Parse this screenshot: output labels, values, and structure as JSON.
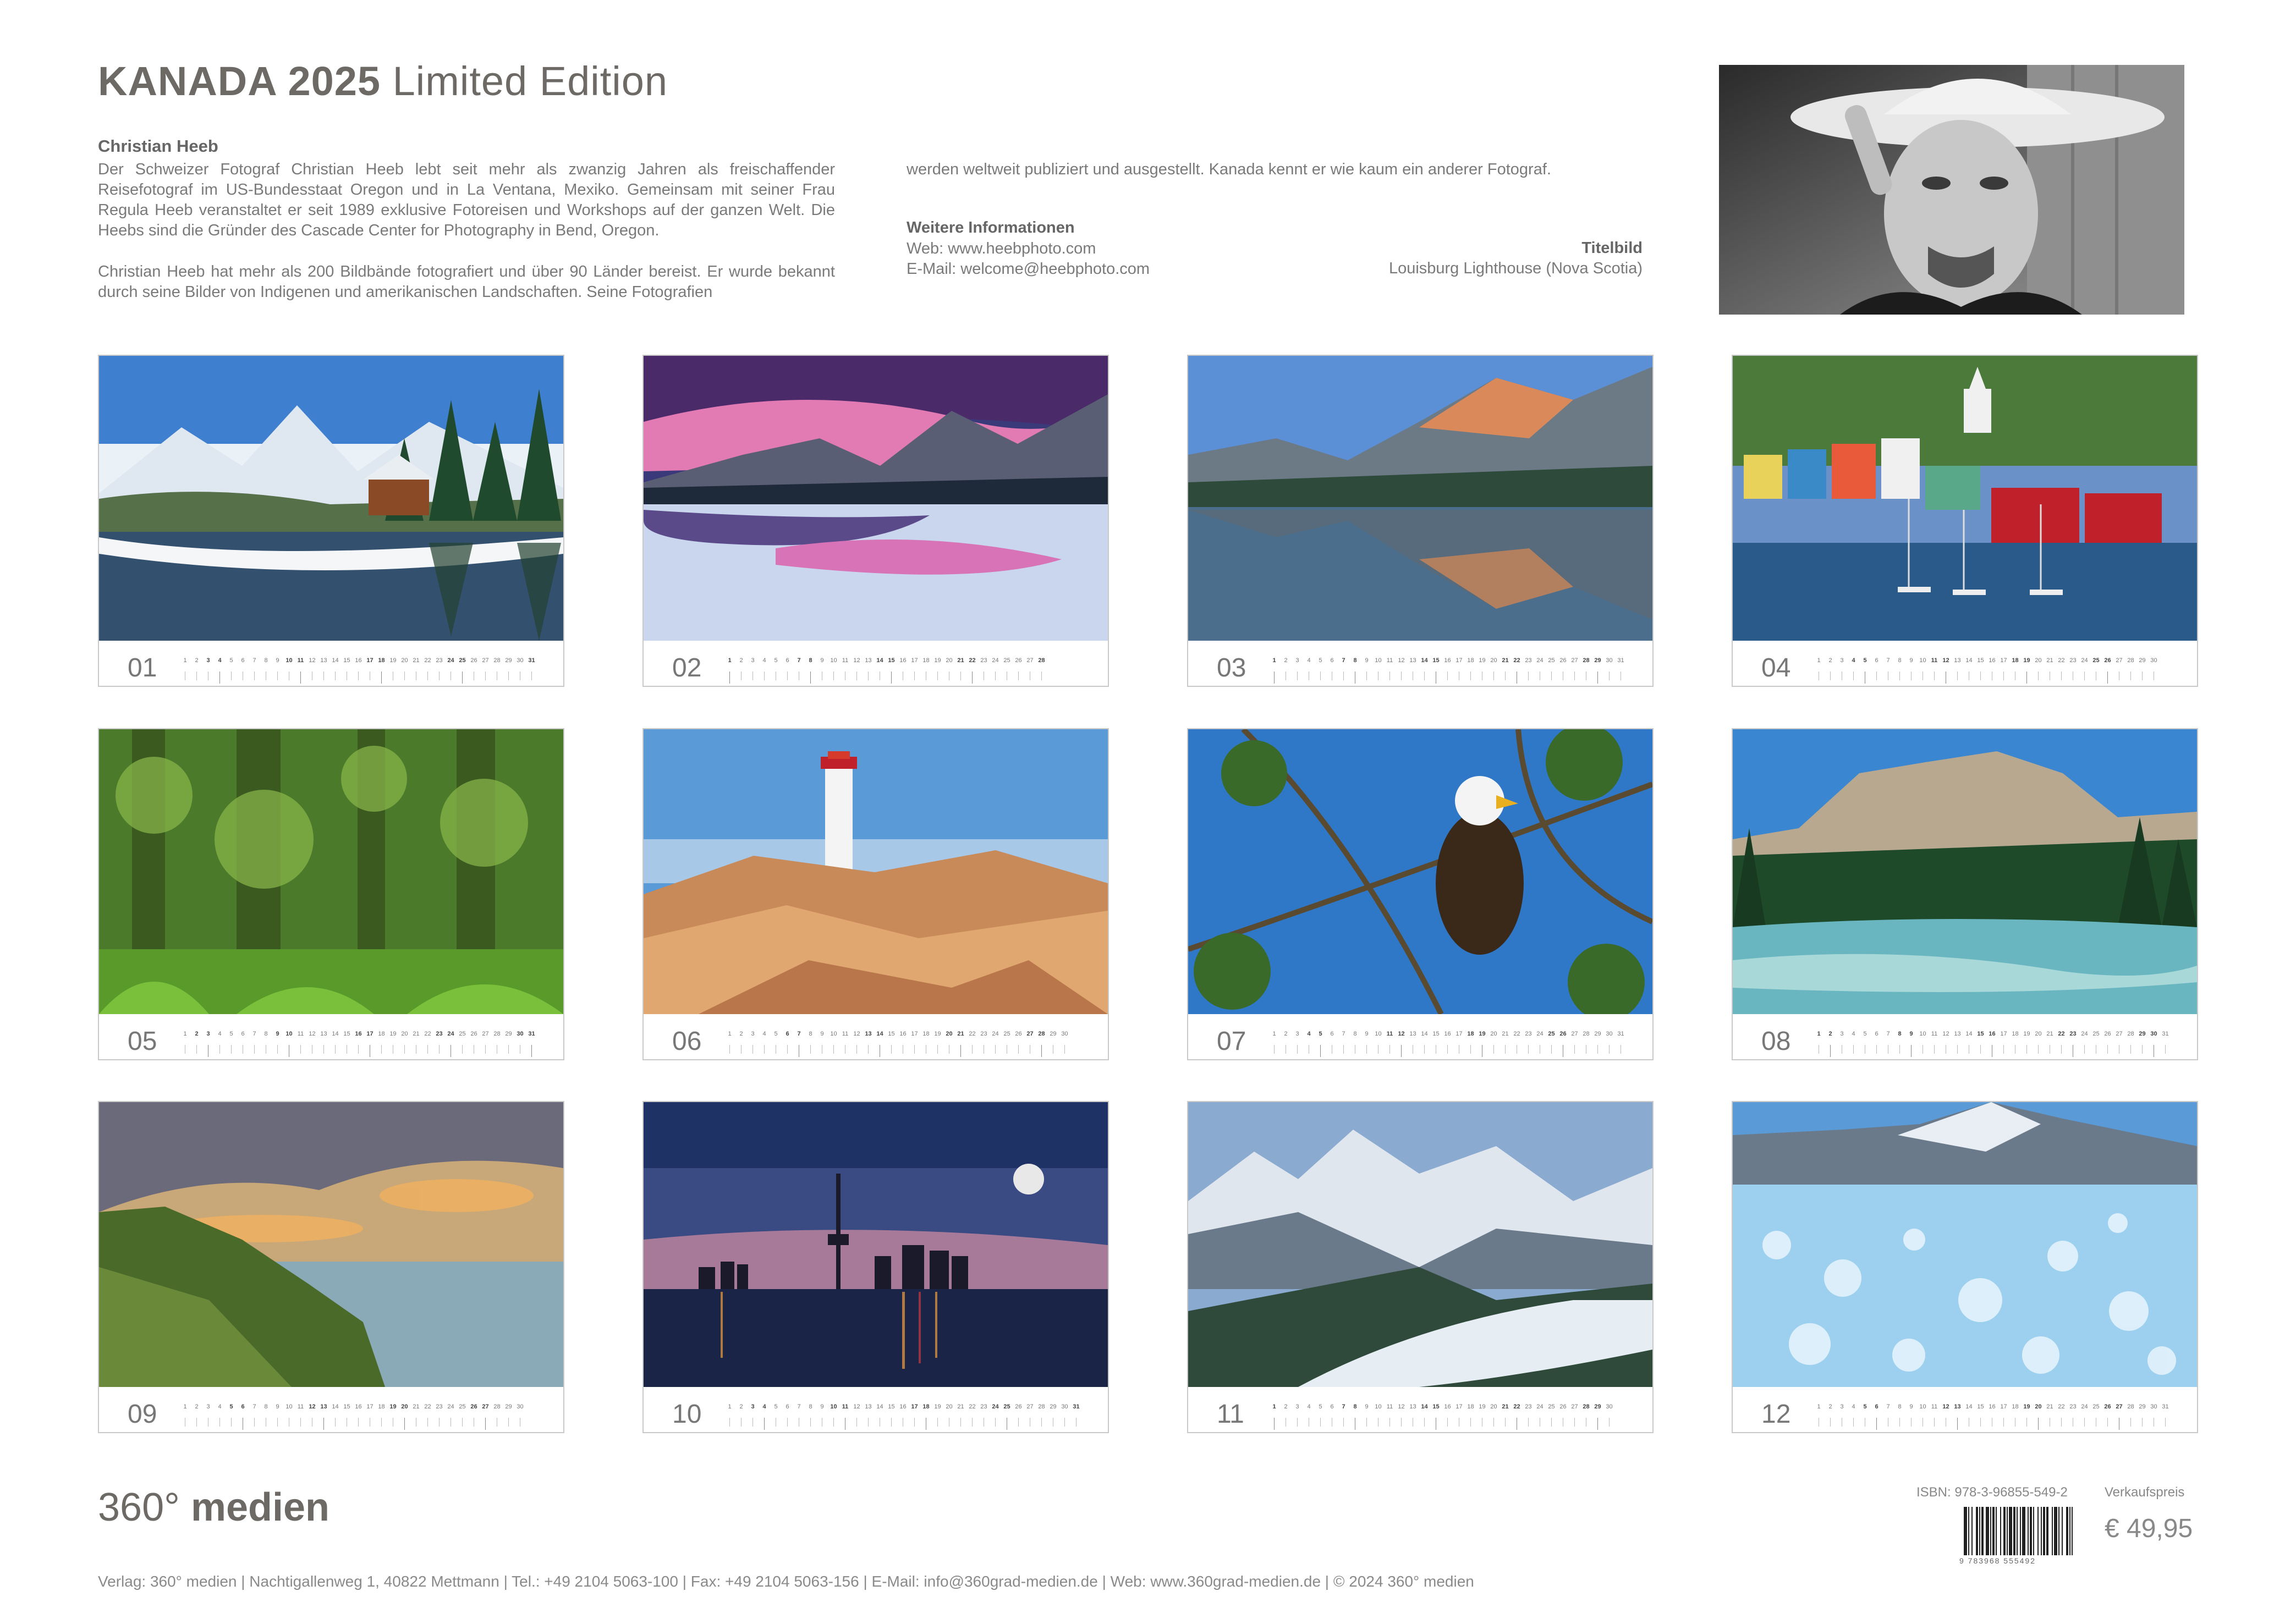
{
  "header": {
    "title_bold": "KANADA 2025",
    "title_light": "Limited Edition"
  },
  "bio": {
    "name": "Christian Heeb",
    "p1": "Der Schweizer Fotograf Christian Heeb lebt seit mehr als zwanzig Jahren als freischaffender Reisefotograf im US-Bundesstaat Oregon und in La Ventana, Mexiko. Gemeinsam mit seiner Frau Regula Heeb veranstaltet er seit 1989 exklusive Fotoreisen und Workshops auf der ganzen Welt. Die Heebs sind die Gründer des Cascade Center for Photography in Bend, Oregon.",
    "p2": "Christian Heeb hat mehr als 200 Bildbände fotografiert und über 90 Länder bereist. Er wurde bekannt durch seine Bilder von Indigenen und amerikanischen Landschaften. Seine Fotografien",
    "p2_cont": "werden weltweit publiziert und ausgestellt. Kanada kennt er wie kaum ein anderer Fotograf."
  },
  "info": {
    "heading": "Weitere Informationen",
    "web": "Web: www.heebphoto.com",
    "email": "E-Mail: welcome@heebphoto.com"
  },
  "cover": {
    "heading": "Titelbild",
    "text": "Louisburg Lighthouse (Nova Scotia)"
  },
  "months": [
    {
      "num": "01",
      "days": 31,
      "first": 3,
      "theme": "winter-lodge"
    },
    {
      "num": "02",
      "days": 28,
      "first": 6,
      "theme": "pink-dawn"
    },
    {
      "num": "03",
      "days": 31,
      "first": 6,
      "theme": "lake-reflection"
    },
    {
      "num": "04",
      "days": 30,
      "first": 2,
      "theme": "harbour-town"
    },
    {
      "num": "05",
      "days": 31,
      "first": 4,
      "theme": "rainforest"
    },
    {
      "num": "06",
      "days": 30,
      "first": 0,
      "theme": "lighthouse"
    },
    {
      "num": "07",
      "days": 31,
      "first": 2,
      "theme": "eagle"
    },
    {
      "num": "08",
      "days": 31,
      "first": 5,
      "theme": "castle-mountain"
    },
    {
      "num": "09",
      "days": 30,
      "first": 1,
      "theme": "coast-sunset"
    },
    {
      "num": "10",
      "days": 31,
      "first": 3,
      "theme": "city-skyline"
    },
    {
      "num": "11",
      "days": 30,
      "first": 6,
      "theme": "glacier-valley"
    },
    {
      "num": "12",
      "days": 31,
      "first": 1,
      "theme": "ice-bubbles"
    }
  ],
  "publisher": {
    "logo_num": "360°",
    "logo_word": "medien",
    "isbn": "ISBN: 978-3-96855-549-2",
    "barcode_digits": "9 783968 555492",
    "price_label": "Verkaufspreis",
    "price": "€ 49,95",
    "footer": "Verlag: 360° medien  |  Nachtigallenweg 1, 40822 Mettmann  |  Tel.: +49 2104 5063-100  |  Fax: +49 2104 5063-156  |  E-Mail: info@360grad-medien.de  |  Web: www.360grad-medien.de  |  © 2024 360° medien"
  }
}
